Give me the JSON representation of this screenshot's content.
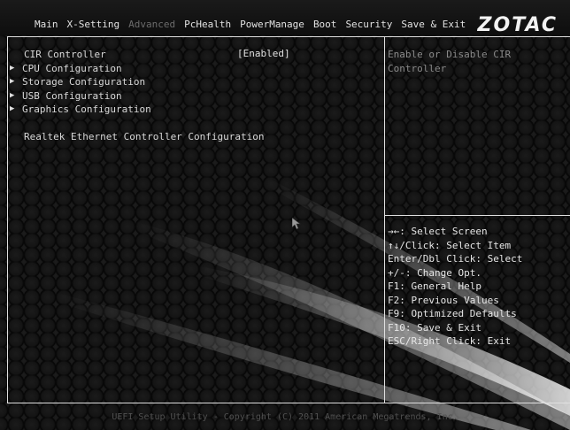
{
  "menu": {
    "tabs": [
      "Main",
      "X-Setting",
      "Advanced",
      "PcHealth",
      "PowerManage",
      "Boot",
      "Security",
      "Save & Exit"
    ],
    "active_index": 2
  },
  "brand": "ZOTAC",
  "settings": {
    "cir_label": "CIR Controller",
    "cir_value": "[Enabled]",
    "submenus": [
      "CPU Configuration",
      "Storage Configuration",
      "USB Configuration",
      "Graphics Configuration"
    ],
    "realtek_label": "Realtek Ethernet Controller Configuration"
  },
  "help": {
    "description": "Enable or Disable CIR Controller"
  },
  "keys": [
    "→←: Select Screen",
    "↑↓/Click: Select Item",
    "Enter/Dbl Click: Select",
    "+/-: Change Opt.",
    "F1: General Help",
    "F2: Previous Values",
    "F9: Optimized Defaults",
    "F10: Save & Exit",
    "ESC/Right Click: Exit"
  ],
  "footer": "UEFI Setup Utility - Copyright (C) 2011 American Megatrends, Inc.",
  "colors": {
    "accent": "#e0e0e0",
    "inactive_tab": "#6c6c6c",
    "help_text": "#8a8a8a"
  }
}
